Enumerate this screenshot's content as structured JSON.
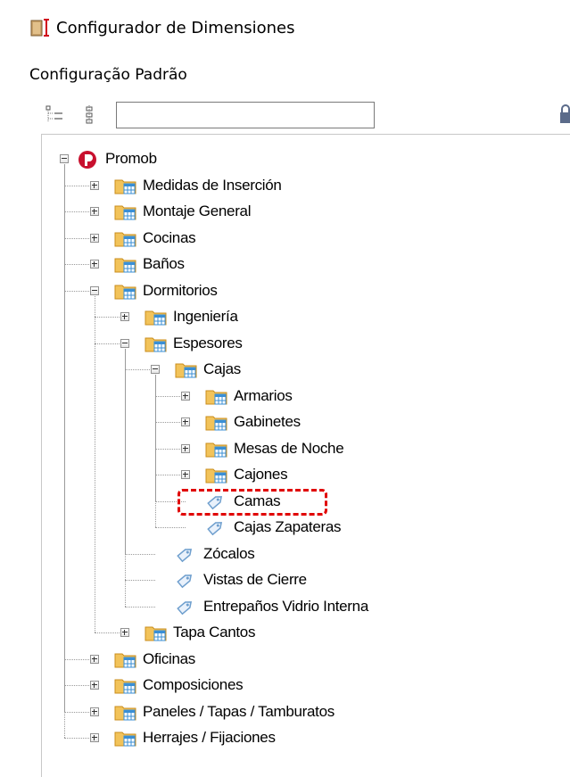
{
  "window": {
    "title": "Configurador de Dimensiones",
    "icon": "door-ruler-icon"
  },
  "config_label": "Configuração Padrão",
  "toolbar": {
    "search_value": "",
    "buttons": [
      "tree-expand-icon",
      "tree-collapse-icon"
    ],
    "right_icon": "lock-icon"
  },
  "tree": {
    "root": "Promob",
    "nodes": [
      {
        "label": "Promob",
        "depth": 0,
        "icon": "promob-logo",
        "state": "expanded"
      },
      {
        "label": "Medidas de Inserción",
        "depth": 1,
        "icon": "folder",
        "state": "collapsed"
      },
      {
        "label": "Montaje General",
        "depth": 1,
        "icon": "folder",
        "state": "collapsed"
      },
      {
        "label": "Cocinas",
        "depth": 1,
        "icon": "folder",
        "state": "collapsed"
      },
      {
        "label": "Baños",
        "depth": 1,
        "icon": "folder",
        "state": "collapsed"
      },
      {
        "label": "Dormitorios",
        "depth": 1,
        "icon": "folder",
        "state": "expanded"
      },
      {
        "label": "Ingeniería",
        "depth": 2,
        "icon": "folder",
        "state": "collapsed"
      },
      {
        "label": "Espesores",
        "depth": 2,
        "icon": "folder",
        "state": "expanded"
      },
      {
        "label": "Cajas",
        "depth": 3,
        "icon": "folder",
        "state": "expanded"
      },
      {
        "label": "Armarios",
        "depth": 4,
        "icon": "folder",
        "state": "collapsed"
      },
      {
        "label": "Gabinetes",
        "depth": 4,
        "icon": "folder",
        "state": "collapsed"
      },
      {
        "label": "Mesas de Noche",
        "depth": 4,
        "icon": "folder",
        "state": "collapsed"
      },
      {
        "label": "Cajones",
        "depth": 4,
        "icon": "folder",
        "state": "collapsed"
      },
      {
        "label": "Camas",
        "depth": 4,
        "icon": "tag",
        "state": "leaf",
        "highlighted": true
      },
      {
        "label": "Cajas Zapateras",
        "depth": 4,
        "icon": "tag",
        "state": "leaf"
      },
      {
        "label": "Zócalos",
        "depth": 3,
        "icon": "tag",
        "state": "leaf"
      },
      {
        "label": "Vistas de Cierre",
        "depth": 3,
        "icon": "tag",
        "state": "leaf"
      },
      {
        "label": "Entrepaños Vidrio Interna",
        "depth": 3,
        "icon": "tag",
        "state": "leaf"
      },
      {
        "label": "Tapa Cantos",
        "depth": 2,
        "icon": "folder",
        "state": "collapsed"
      },
      {
        "label": "Oficinas",
        "depth": 1,
        "icon": "folder",
        "state": "collapsed"
      },
      {
        "label": "Composiciones",
        "depth": 1,
        "icon": "folder",
        "state": "collapsed"
      },
      {
        "label": "Paneles / Tapas / Tamburatos",
        "depth": 1,
        "icon": "folder",
        "state": "collapsed"
      },
      {
        "label": "Herrajes / Fijaciones",
        "depth": 1,
        "icon": "folder",
        "state": "collapsed"
      }
    ]
  },
  "colors": {
    "highlight": "#e00000",
    "folder": "#f2c35a",
    "table_badge": "#3a8fd6",
    "tag": "#6f9fce"
  }
}
